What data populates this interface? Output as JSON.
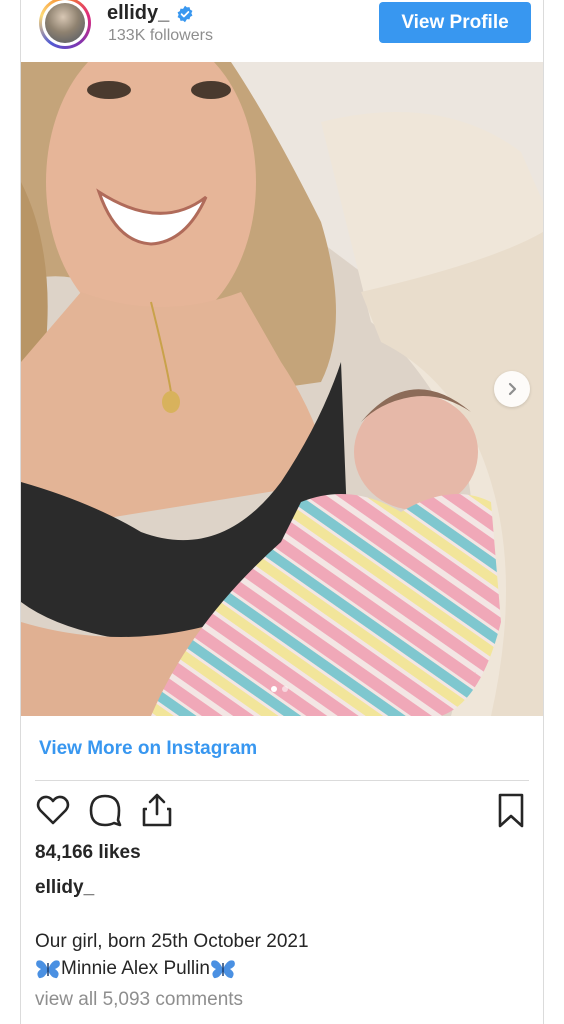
{
  "header": {
    "username": "ellidy_",
    "followers": "133K followers",
    "view_profile_label": "View Profile",
    "verified_color": "#3897f0"
  },
  "media": {
    "carousel_dots": 2,
    "active_dot": 1,
    "next_icon": "chevron-right-icon"
  },
  "view_more_label": "View More on Instagram",
  "actions": {
    "icons": [
      "heart-icon",
      "comment-icon",
      "share-icon",
      "bookmark-icon"
    ]
  },
  "likes": "84,166 likes",
  "caption": {
    "username": "ellidy_",
    "line1": "Our girl, born 25th October 2021",
    "line2": "Minnie Alex Pullin",
    "emoji": "butterfly-icon"
  },
  "comments_link": "view all 5,093 comments",
  "colors": {
    "accent": "#3897f0",
    "text": "#262626",
    "muted": "#8e8e8e",
    "divider": "#dbdbdb"
  }
}
